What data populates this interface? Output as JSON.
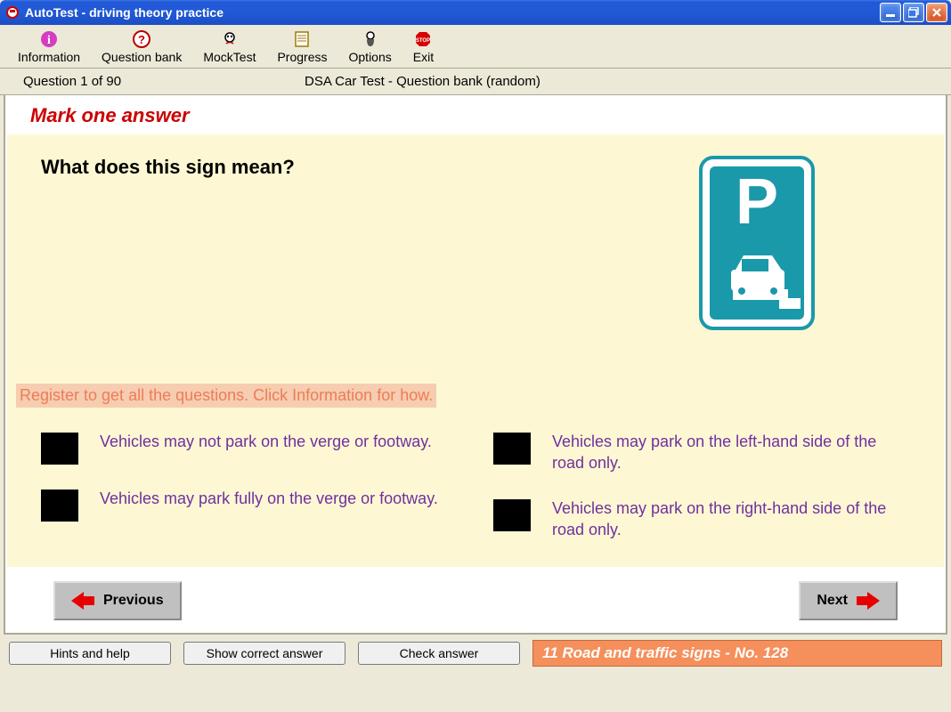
{
  "window": {
    "title": "AutoTest - driving theory practice"
  },
  "toolbar": {
    "items": [
      {
        "label": "Information"
      },
      {
        "label": "Question bank"
      },
      {
        "label": "MockTest"
      },
      {
        "label": "Progress"
      },
      {
        "label": "Options"
      },
      {
        "label": "Exit"
      }
    ]
  },
  "status": {
    "left": "Question 1 of 90",
    "center": "DSA Car Test - Question bank (random)"
  },
  "instruction": "Mark one answer",
  "question": "What does this sign mean?",
  "register_notice": "Register to get all the questions. Click Information for how.",
  "answers": [
    "Vehicles may not park on the verge or footway.",
    "Vehicles may park fully on the verge or footway.",
    "Vehicles may park on the left-hand side of the road only.",
    "Vehicles may park on the right-hand side of the road only."
  ],
  "nav": {
    "prev": "Previous",
    "next": "Next"
  },
  "bottom": {
    "hints": "Hints and help",
    "show_correct": "Show correct answer",
    "check": "Check answer",
    "category": "11  Road and traffic signs - No. 128"
  }
}
